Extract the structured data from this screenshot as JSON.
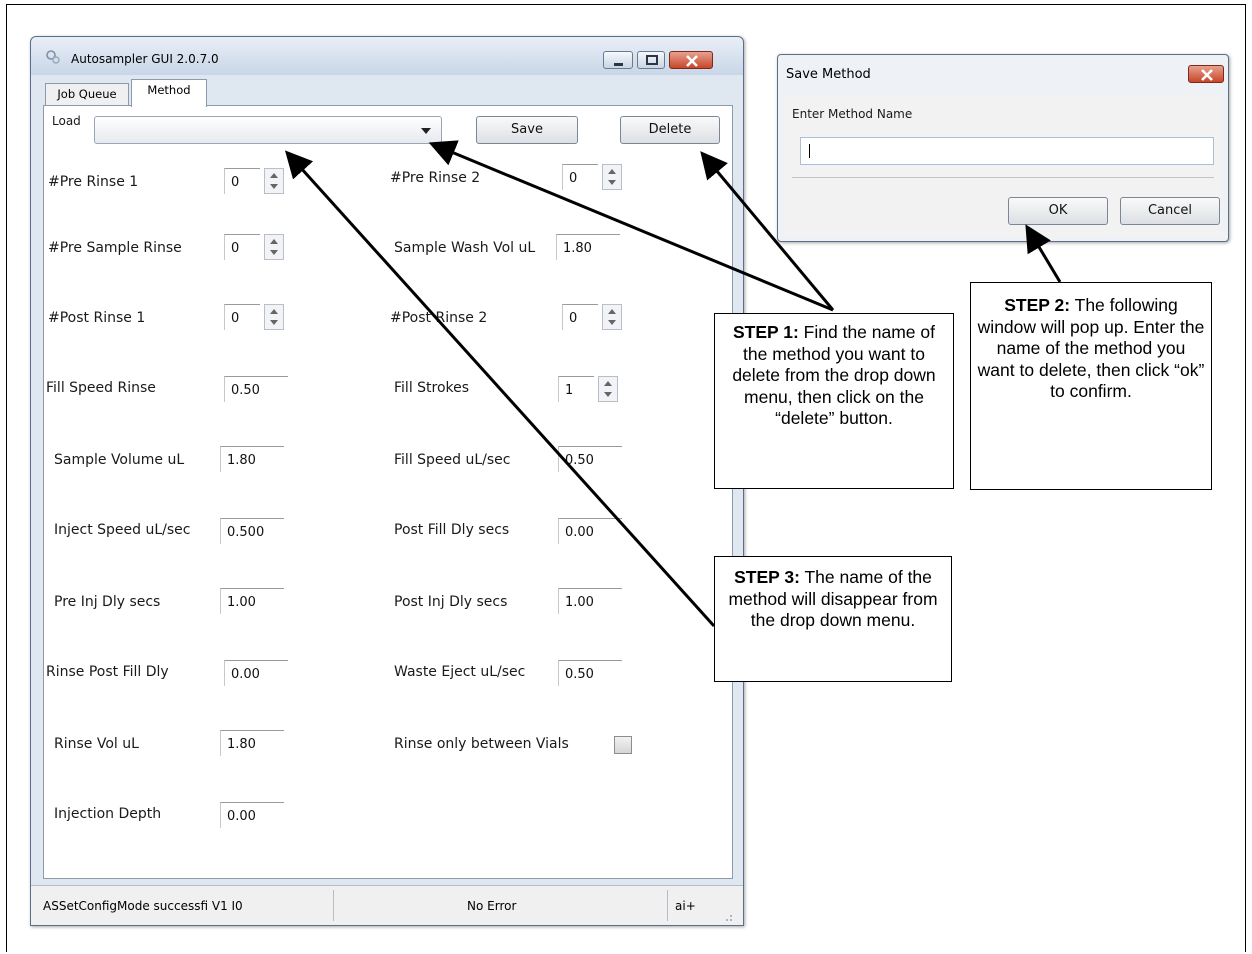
{
  "window": {
    "title": "Autosampler GUI 2.0.7.0",
    "tabs": [
      "Job Queue",
      "Method"
    ],
    "active_tab": "Method"
  },
  "method": {
    "load_label": "Load",
    "load_value": "",
    "save_label": "Save",
    "delete_label": "Delete",
    "fields": {
      "pre_rinse_1": {
        "label": "#Pre Rinse 1",
        "value": "0"
      },
      "pre_rinse_2": {
        "label": "#Pre Rinse 2",
        "value": "0"
      },
      "pre_sample_rinse": {
        "label": "#Pre Sample Rinse",
        "value": "0"
      },
      "sample_wash_vol": {
        "label": "Sample Wash Vol uL",
        "value": "1.80"
      },
      "post_rinse_1": {
        "label": "#Post Rinse 1",
        "value": "0"
      },
      "post_rinse_2": {
        "label": "#Post Rinse 2",
        "value": "0"
      },
      "fill_speed_rinse": {
        "label": "Fill Speed Rinse",
        "value": "0.50"
      },
      "fill_strokes": {
        "label": "Fill Strokes",
        "value": "1"
      },
      "sample_volume": {
        "label": "Sample Volume uL",
        "value": "1.80"
      },
      "fill_speed": {
        "label": "Fill Speed uL/sec",
        "value": "0.50"
      },
      "inject_speed": {
        "label": "Inject Speed uL/sec",
        "value": "0.500"
      },
      "post_fill_dly": {
        "label": "Post Fill Dly secs",
        "value": "0.00"
      },
      "pre_inj_dly": {
        "label": "Pre Inj Dly secs",
        "value": "1.00"
      },
      "post_inj_dly": {
        "label": "Post Inj Dly secs",
        "value": "1.00"
      },
      "rinse_post_fill_dly": {
        "label": "Rinse Post Fill Dly",
        "value": "0.00"
      },
      "waste_eject": {
        "label": "Waste Eject uL/sec",
        "value": "0.50"
      },
      "rinse_vol": {
        "label": "Rinse Vol uL",
        "value": "1.80"
      },
      "rinse_only_between_vials": {
        "label": "Rinse only between Vials",
        "checked": false
      },
      "injection_depth": {
        "label": "Injection Depth",
        "value": "0.00"
      }
    }
  },
  "status": {
    "message": "ASSetConfigMode successfi V1 I0",
    "error": "No Error",
    "mode": "ai+"
  },
  "dialog": {
    "title": "Save Method",
    "prompt": "Enter Method Name",
    "value": "",
    "ok_label": "OK",
    "cancel_label": "Cancel"
  },
  "callouts": {
    "step1_heading": "STEP 1:",
    "step1_text": " Find the name of the method you want to delete from the drop down menu, then click on the “delete” button.",
    "step2_heading": "STEP 2:",
    "step2_text": " The following window will pop up. Enter the name of the method you want to delete, then click “ok” to confirm.",
    "step3_heading": "STEP 3:",
    "step3_text": " The name of the method will disappear from the drop down menu."
  }
}
